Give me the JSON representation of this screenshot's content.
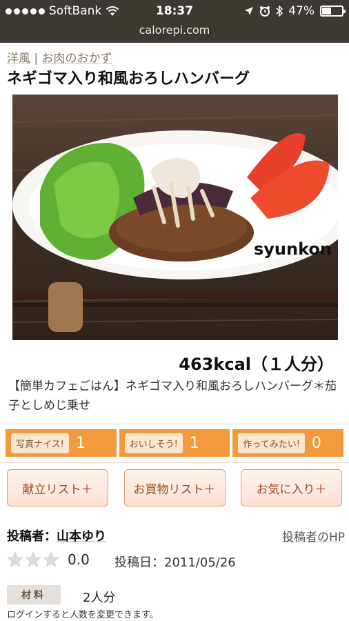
{
  "status_bar": {
    "carrier": "SoftBank",
    "time": "18:37",
    "battery": "47%",
    "battery_level": 0.47,
    "url": "calorepi.com"
  },
  "breadcrumb": {
    "items": [
      "洋風",
      "お肉のおかず"
    ],
    "separator": "|"
  },
  "recipe": {
    "title": "ネギゴマ入り和風おろしハンバーグ",
    "photo_watermark": "syunkon",
    "calories": "463kcal（１人分）",
    "description": "【簡単カフェごはん】ネギゴマ入り和風おろしハンバーグ＊茄子としめじ乗せ"
  },
  "reactions": [
    {
      "label": "写真ナイス!",
      "count": "1"
    },
    {
      "label": "おいしそう!",
      "count": "1"
    },
    {
      "label": "作ってみたい!",
      "count": "0"
    }
  ],
  "actions": [
    {
      "label": "献立リスト＋"
    },
    {
      "label": "お買物リスト＋"
    },
    {
      "label": "お気に入り＋"
    }
  ],
  "author": {
    "label": "投稿者：",
    "name": "山本ゆり",
    "hp_link": "投稿者のHP"
  },
  "rating": {
    "value": "0.0",
    "stars_filled": 0,
    "stars_total": 3
  },
  "post_date": "投稿日：2011/05/26",
  "ingredients": {
    "tag": "材料",
    "servings": "2人分",
    "login_note": "ログインすると人数を変更できます。"
  },
  "colors": {
    "status_bar_bg": "#3e3833",
    "reaction_bar": "#f39a3c",
    "action_border": "#e69a6e",
    "action_text": "#9a4a24"
  }
}
